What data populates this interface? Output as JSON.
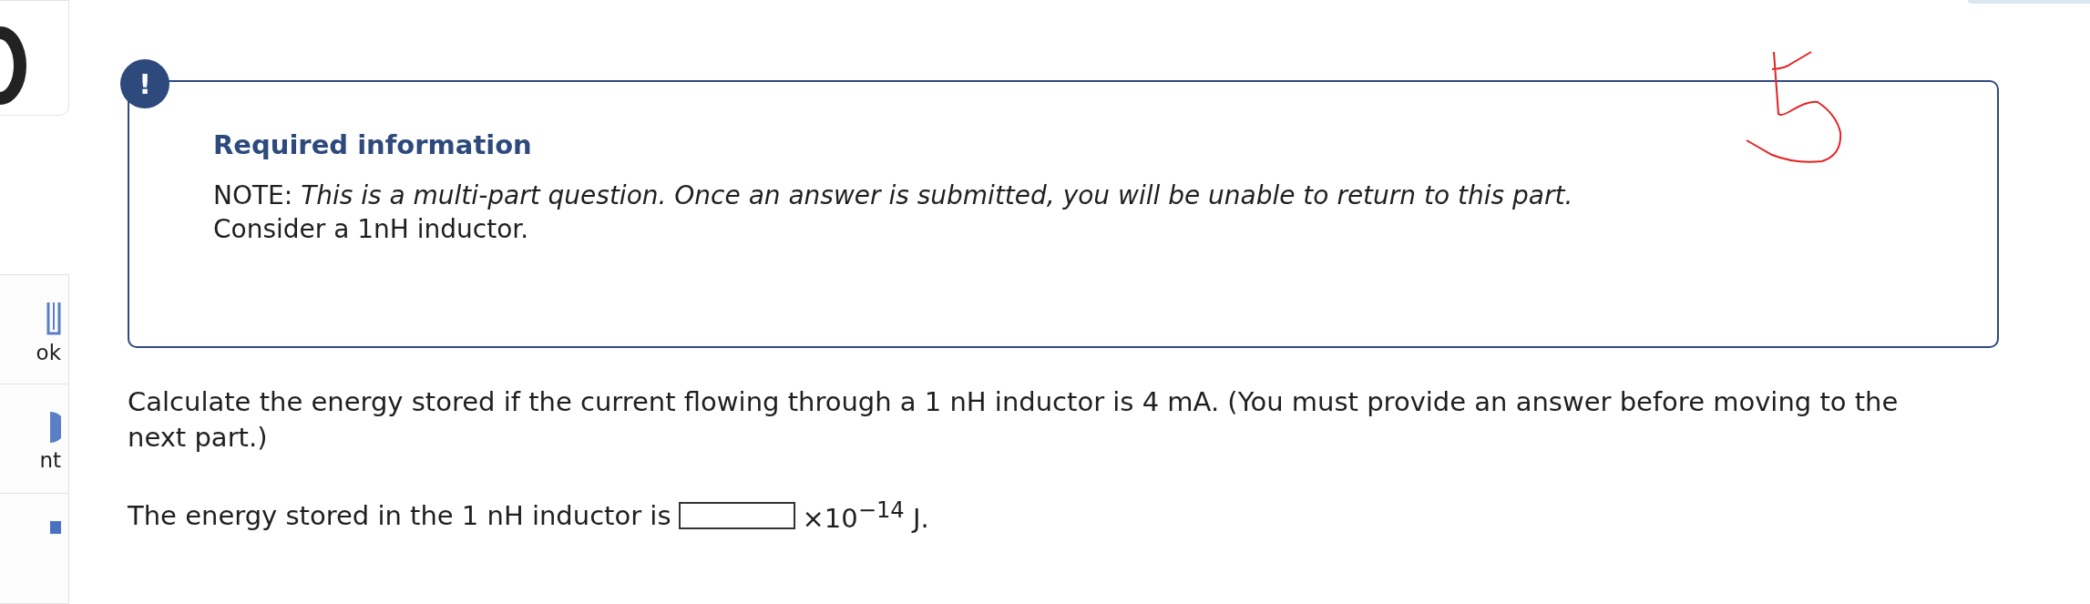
{
  "sidebar": {
    "items": [
      {
        "kind": "book",
        "label": "ok"
      },
      {
        "kind": "print",
        "label": "nt"
      },
      {
        "kind": "more"
      }
    ]
  },
  "notice": {
    "badge": "!",
    "title": "Required information",
    "note": "NOTE: *This is a multi-part question. Once an answer is submitted, you will be unable to return to this part.*",
    "context": "Consider a 1nH inductor."
  },
  "question": {
    "text": "Calculate the energy stored if the current flowing through a 1 nH inductor is 4 mA. (You must provide an answer before moving to the next part.)"
  },
  "answer": {
    "prefix": "The energy stored in the 1 nH inductor is",
    "suffix": "×10$^{−14}$ J."
  }
}
